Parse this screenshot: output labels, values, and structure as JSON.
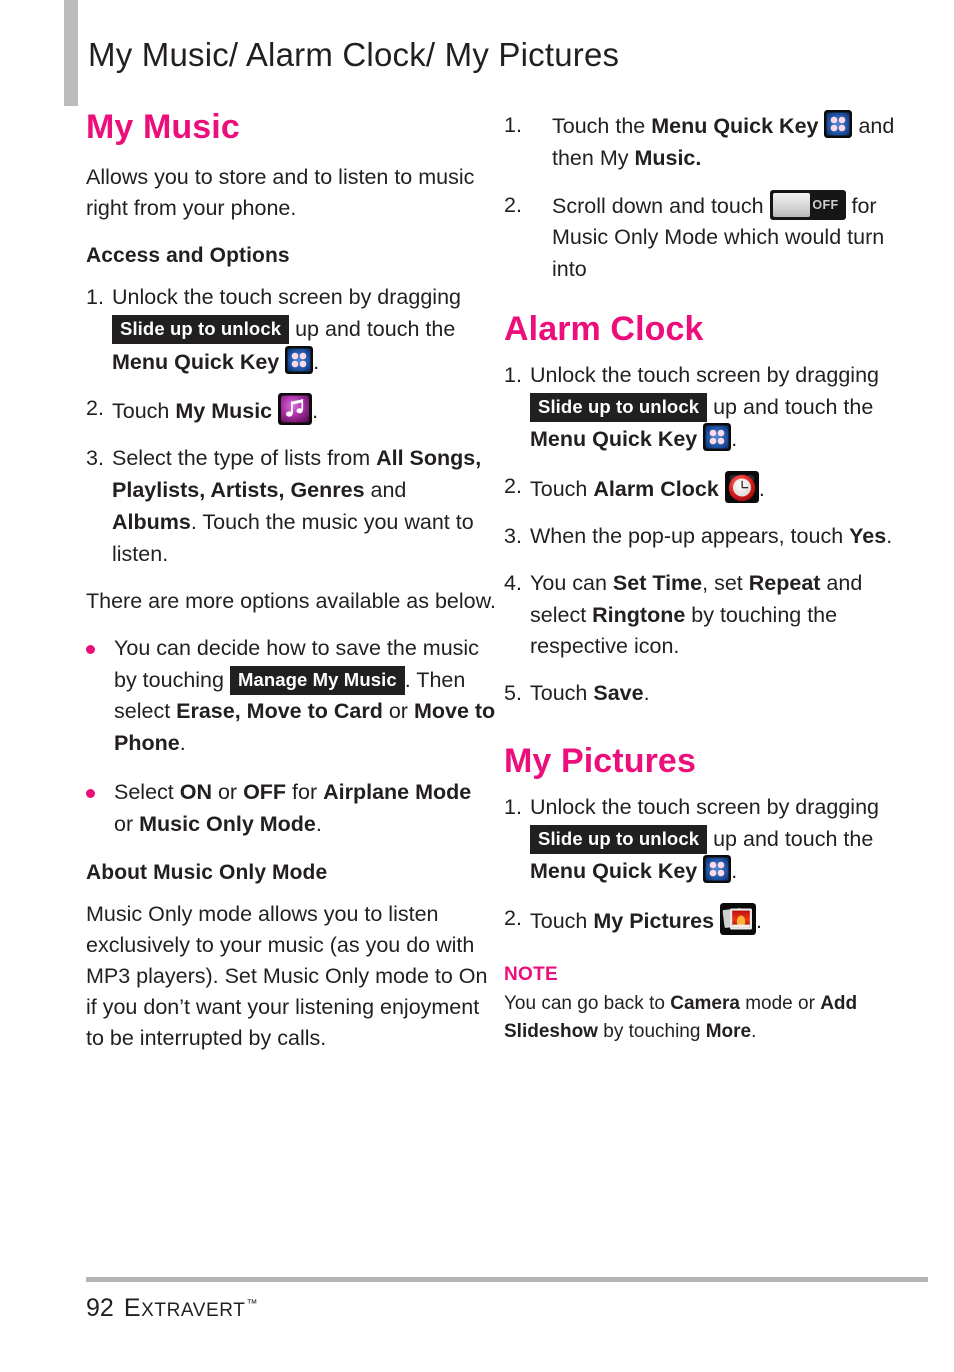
{
  "header": {
    "title": "My Music/ Alarm Clock/ My Pictures"
  },
  "colors": {
    "accent_pink": "#ec0e7b",
    "body_text": "#231f20",
    "badge_bg": "#211f20",
    "edge_bar": "#bcbcbc",
    "footer_rule": "#b4b4b4"
  },
  "badges": {
    "slide_up_to_unlock": "Slide up to unlock",
    "manage_my_music": "Manage My Music",
    "toggle_off": "OFF"
  },
  "icons": {
    "menu_quick_key": "menu-quick-key-icon",
    "my_music": "my-music-icon",
    "alarm_clock": "alarm-clock-icon",
    "my_pictures": "my-pictures-icon",
    "toggle": "off-toggle-icon"
  },
  "left_column": {
    "section_title": "My Music",
    "intro": "Allows you to store and to listen to music right from your phone.",
    "subheading_access": "Access and Options",
    "steps": [
      {
        "num": "1.",
        "parts": [
          {
            "t": "text",
            "v": "Unlock the touch screen by dragging "
          },
          {
            "t": "badge",
            "v": "Slide up to unlock"
          },
          {
            "t": "text",
            "v": " up and touch the "
          },
          {
            "t": "bold",
            "v": "Menu Quick Key"
          },
          {
            "t": "icon",
            "v": "menu-quick-key-icon"
          },
          {
            "t": "text",
            "v": "."
          }
        ]
      },
      {
        "num": "2.",
        "parts": [
          {
            "t": "text",
            "v": "Touch "
          },
          {
            "t": "bold",
            "v": "My Music"
          },
          {
            "t": "icon",
            "v": "my-music-icon"
          },
          {
            "t": "text",
            "v": "."
          }
        ]
      },
      {
        "num": "3.",
        "parts": [
          {
            "t": "text",
            "v": "Select the type of lists from "
          },
          {
            "t": "bold",
            "v": "All Songs, Playlists, Artists, Genres"
          },
          {
            "t": "text",
            "v": " and "
          },
          {
            "t": "bold",
            "v": "Albums"
          },
          {
            "t": "text",
            "v": ". Touch the music you want to listen."
          }
        ]
      }
    ],
    "more_options_intro": "There are more options available as below.",
    "bullets": [
      {
        "parts": [
          {
            "t": "text",
            "v": "You can decide how to save the music by touching "
          },
          {
            "t": "badge",
            "v": "Manage My Music"
          },
          {
            "t": "text",
            "v": ". Then select "
          },
          {
            "t": "bold",
            "v": "Erase, Move to Card"
          },
          {
            "t": "text",
            "v": " or "
          },
          {
            "t": "bold",
            "v": "Move to Phone"
          },
          {
            "t": "text",
            "v": "."
          }
        ]
      },
      {
        "parts": [
          {
            "t": "text",
            "v": "Select "
          },
          {
            "t": "bold",
            "v": "ON"
          },
          {
            "t": "text",
            "v": " or "
          },
          {
            "t": "bold",
            "v": "OFF"
          },
          {
            "t": "text",
            "v": " for "
          },
          {
            "t": "bold",
            "v": "Airplane Mode"
          },
          {
            "t": "text",
            "v": " or "
          },
          {
            "t": "bold",
            "v": "Music Only Mode"
          },
          {
            "t": "text",
            "v": "."
          }
        ]
      }
    ],
    "subheading_about": "About Music Only Mode",
    "about_body": "Music Only mode allows you to listen exclusively to your music (as you do with MP3 players). Set Music Only mode to On if you don’t want your listening enjoyment to be interrupted by calls."
  },
  "right_column": {
    "music_only_steps": [
      {
        "num": "1.",
        "parts": [
          {
            "t": "text",
            "v": "Touch the "
          },
          {
            "t": "bold",
            "v": "Menu Quick Key"
          },
          {
            "t": "icon",
            "v": "menu-quick-key-icon"
          },
          {
            "t": "text",
            "v": " and then My "
          },
          {
            "t": "bold",
            "v": "Music."
          }
        ]
      },
      {
        "num": "2.",
        "parts": [
          {
            "t": "text",
            "v": "Scroll down and touch "
          },
          {
            "t": "toggle",
            "v": "OFF"
          },
          {
            "t": "text",
            "v": " for Music Only Mode which would turn into"
          }
        ]
      }
    ],
    "alarm_clock": {
      "section_title": "Alarm Clock",
      "steps": [
        {
          "num": "1.",
          "parts": [
            {
              "t": "text",
              "v": "Unlock the touch screen by dragging "
            },
            {
              "t": "badge",
              "v": "Slide up to unlock"
            },
            {
              "t": "text",
              "v": " up and touch the "
            },
            {
              "t": "bold",
              "v": "Menu Quick Key"
            },
            {
              "t": "icon",
              "v": "menu-quick-key-icon"
            },
            {
              "t": "text",
              "v": "."
            }
          ]
        },
        {
          "num": "2.",
          "parts": [
            {
              "t": "text",
              "v": "Touch "
            },
            {
              "t": "bold",
              "v": "Alarm Clock"
            },
            {
              "t": "icon",
              "v": "alarm-clock-icon"
            },
            {
              "t": "text",
              "v": "."
            }
          ]
        },
        {
          "num": "3.",
          "parts": [
            {
              "t": "text",
              "v": "When the pop-up appears, touch "
            },
            {
              "t": "bold",
              "v": "Yes"
            },
            {
              "t": "text",
              "v": "."
            }
          ]
        },
        {
          "num": "4.",
          "parts": [
            {
              "t": "text",
              "v": "You can "
            },
            {
              "t": "bold",
              "v": "Set Time"
            },
            {
              "t": "text",
              "v": ", set "
            },
            {
              "t": "bold",
              "v": "Repeat"
            },
            {
              "t": "text",
              "v": " and select "
            },
            {
              "t": "bold",
              "v": "Ringtone"
            },
            {
              "t": "text",
              "v": " by touching the respective icon."
            }
          ]
        },
        {
          "num": "5.",
          "parts": [
            {
              "t": "text",
              "v": "Touch "
            },
            {
              "t": "bold",
              "v": "Save"
            },
            {
              "t": "text",
              "v": "."
            }
          ]
        }
      ]
    },
    "my_pictures": {
      "section_title": "My Pictures",
      "steps": [
        {
          "num": "1.",
          "parts": [
            {
              "t": "text",
              "v": "Unlock the touch screen by dragging "
            },
            {
              "t": "badge",
              "v": "Slide up to unlock"
            },
            {
              "t": "text",
              "v": " up and touch the "
            },
            {
              "t": "bold",
              "v": "Menu Quick Key"
            },
            {
              "t": "icon",
              "v": "menu-quick-key-icon"
            },
            {
              "t": "text",
              "v": "."
            }
          ]
        },
        {
          "num": "2.",
          "parts": [
            {
              "t": "text",
              "v": "Touch "
            },
            {
              "t": "bold",
              "v": "My Pictures"
            },
            {
              "t": "icon",
              "v": "my-pictures-icon"
            },
            {
              "t": "text",
              "v": "."
            }
          ]
        }
      ]
    },
    "note": {
      "label": "NOTE",
      "parts": [
        {
          "t": "text",
          "v": "You can go back to "
        },
        {
          "t": "bold",
          "v": "Camera"
        },
        {
          "t": "text",
          "v": " mode or "
        },
        {
          "t": "bold",
          "v": "Add Slideshow"
        },
        {
          "t": "text",
          "v": " by touching "
        },
        {
          "t": "bold",
          "v": "More"
        },
        {
          "t": "text",
          "v": "."
        }
      ]
    }
  },
  "footer": {
    "page_number": "92",
    "brand_cap": "E",
    "brand_rest": "XTRAVERT",
    "trademark": "™"
  }
}
